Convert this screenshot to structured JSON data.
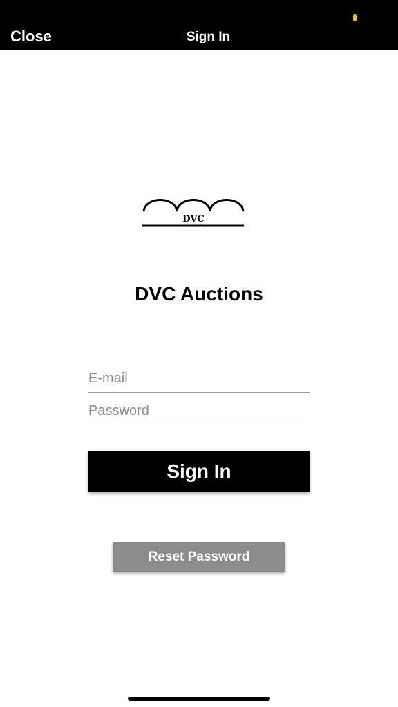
{
  "nav": {
    "close_label": "Close",
    "title": "Sign In"
  },
  "status": {
    "indicator_color": "#f5c518"
  },
  "logo": {
    "text": "DVC",
    "icon": "three-arches-logo"
  },
  "app": {
    "title": "DVC Auctions"
  },
  "form": {
    "email_placeholder": "E-mail",
    "email_value": "",
    "password_placeholder": "Password",
    "password_value": "",
    "signin_label": "Sign In",
    "reset_label": "Reset Password"
  },
  "colors": {
    "primary": "#000000",
    "secondary_button": "#8c8c8c",
    "background": "#ffffff"
  }
}
